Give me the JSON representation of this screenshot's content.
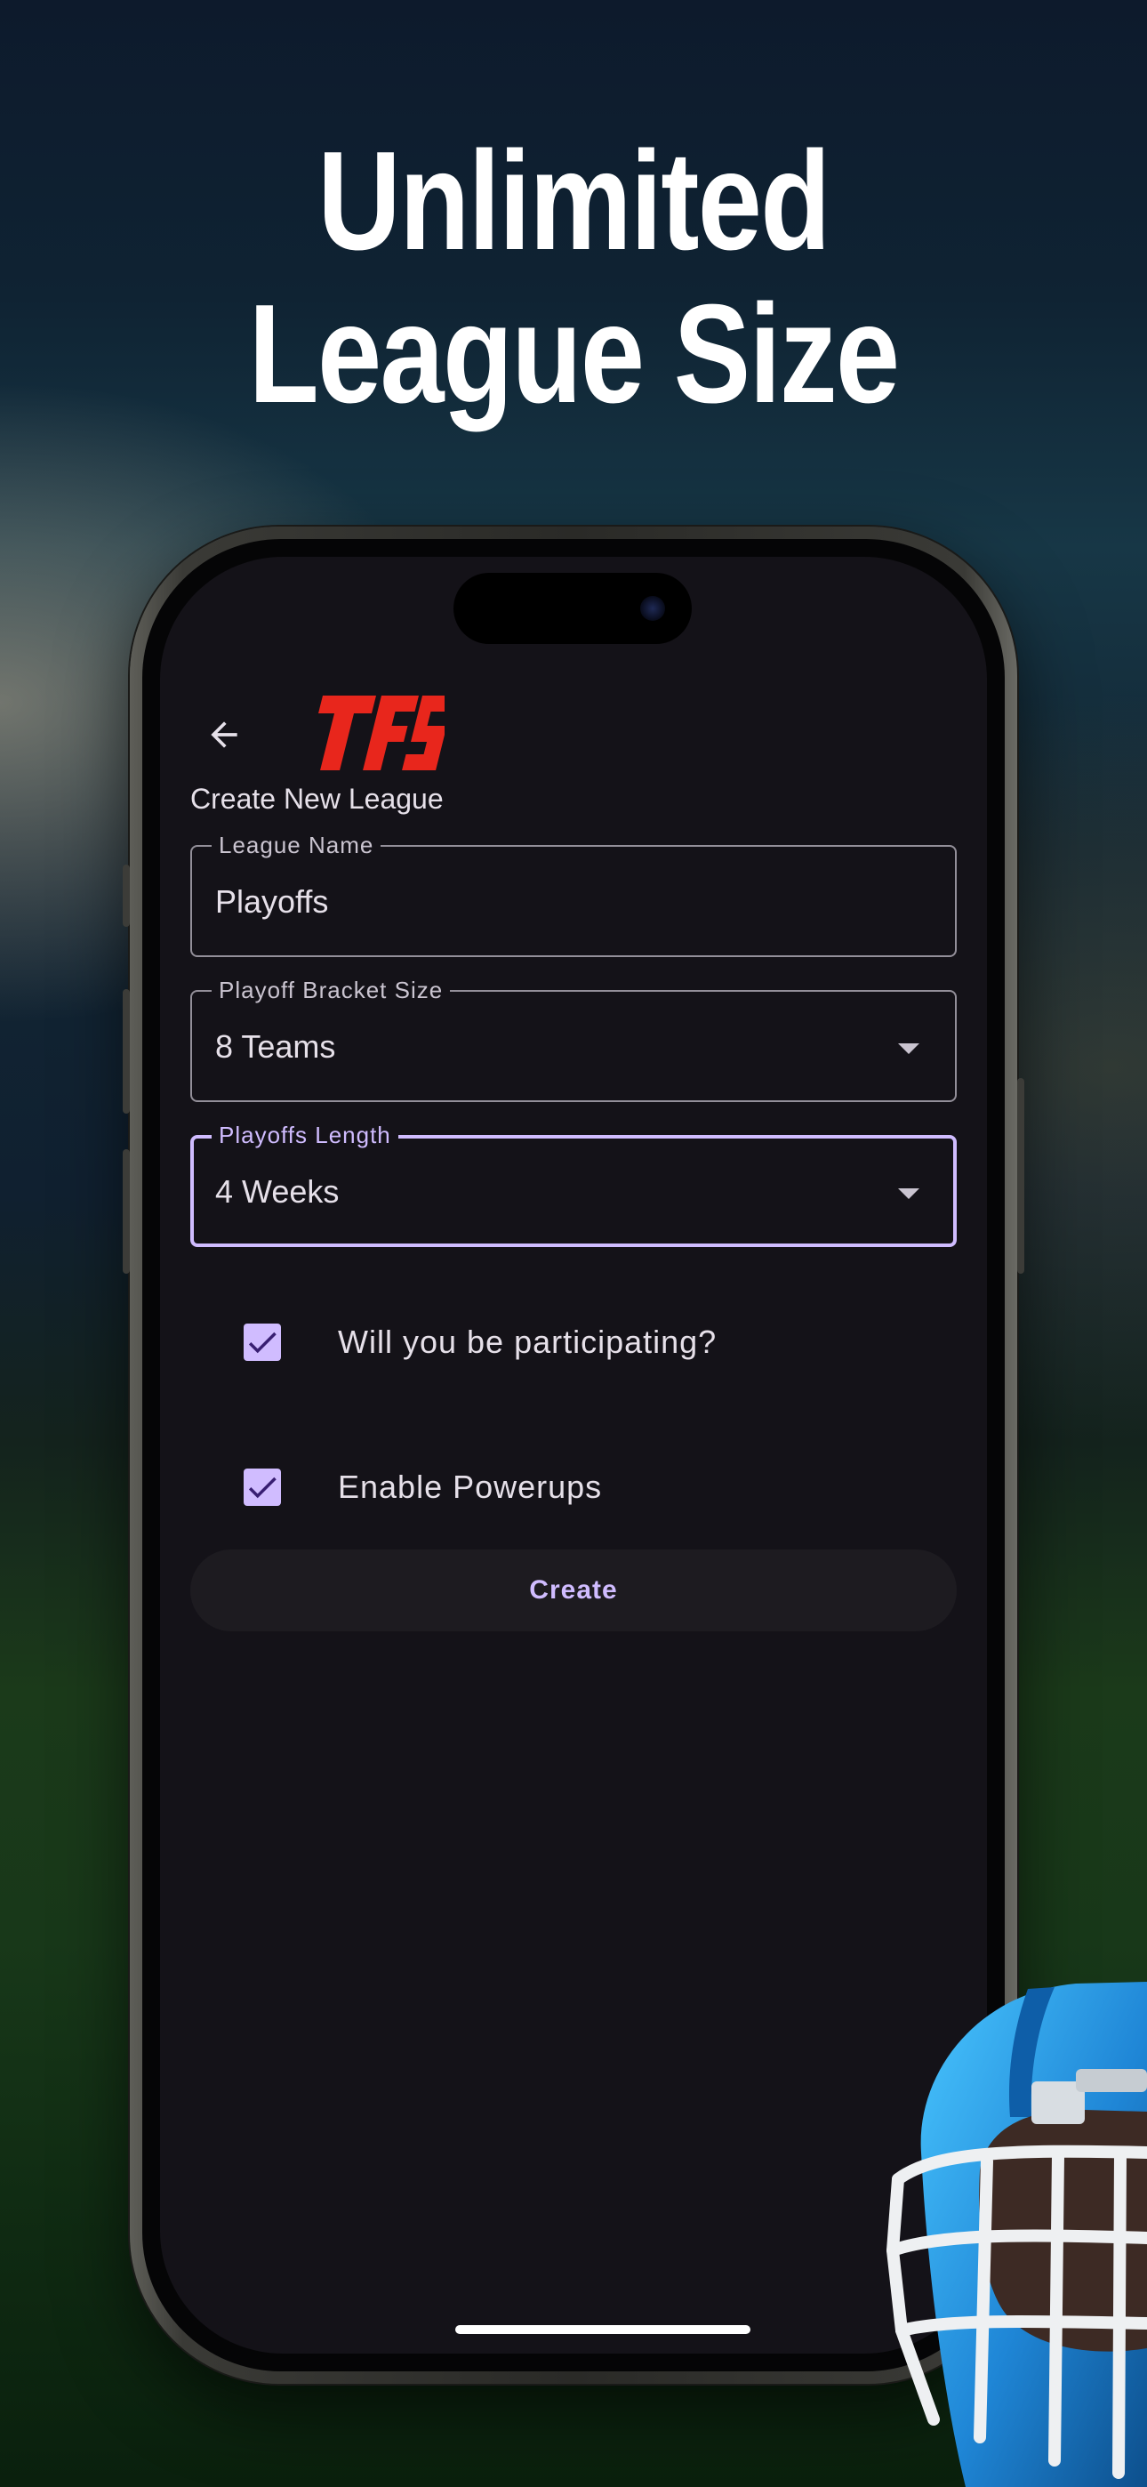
{
  "headline": {
    "line1": "Unlimited",
    "line2": "League Size"
  },
  "app": {
    "logo_text": "TFS",
    "back_icon": "arrow-left-icon",
    "screen_title": "Create New League"
  },
  "form": {
    "league_name": {
      "label": "League Name",
      "value": "Playoffs"
    },
    "bracket_size": {
      "label": "Playoff Bracket Size",
      "value": "8 Teams"
    },
    "playoffs_length": {
      "label": "Playoffs Length",
      "value": "4 Weeks"
    },
    "participating": {
      "label": "Will you be participating?",
      "checked": true
    },
    "powerups": {
      "label": "Enable Powerups",
      "checked": true
    },
    "create_label": "Create"
  },
  "colors": {
    "accent": "#d0bcff",
    "surface": "#141218",
    "logo_red": "#e8261c"
  }
}
